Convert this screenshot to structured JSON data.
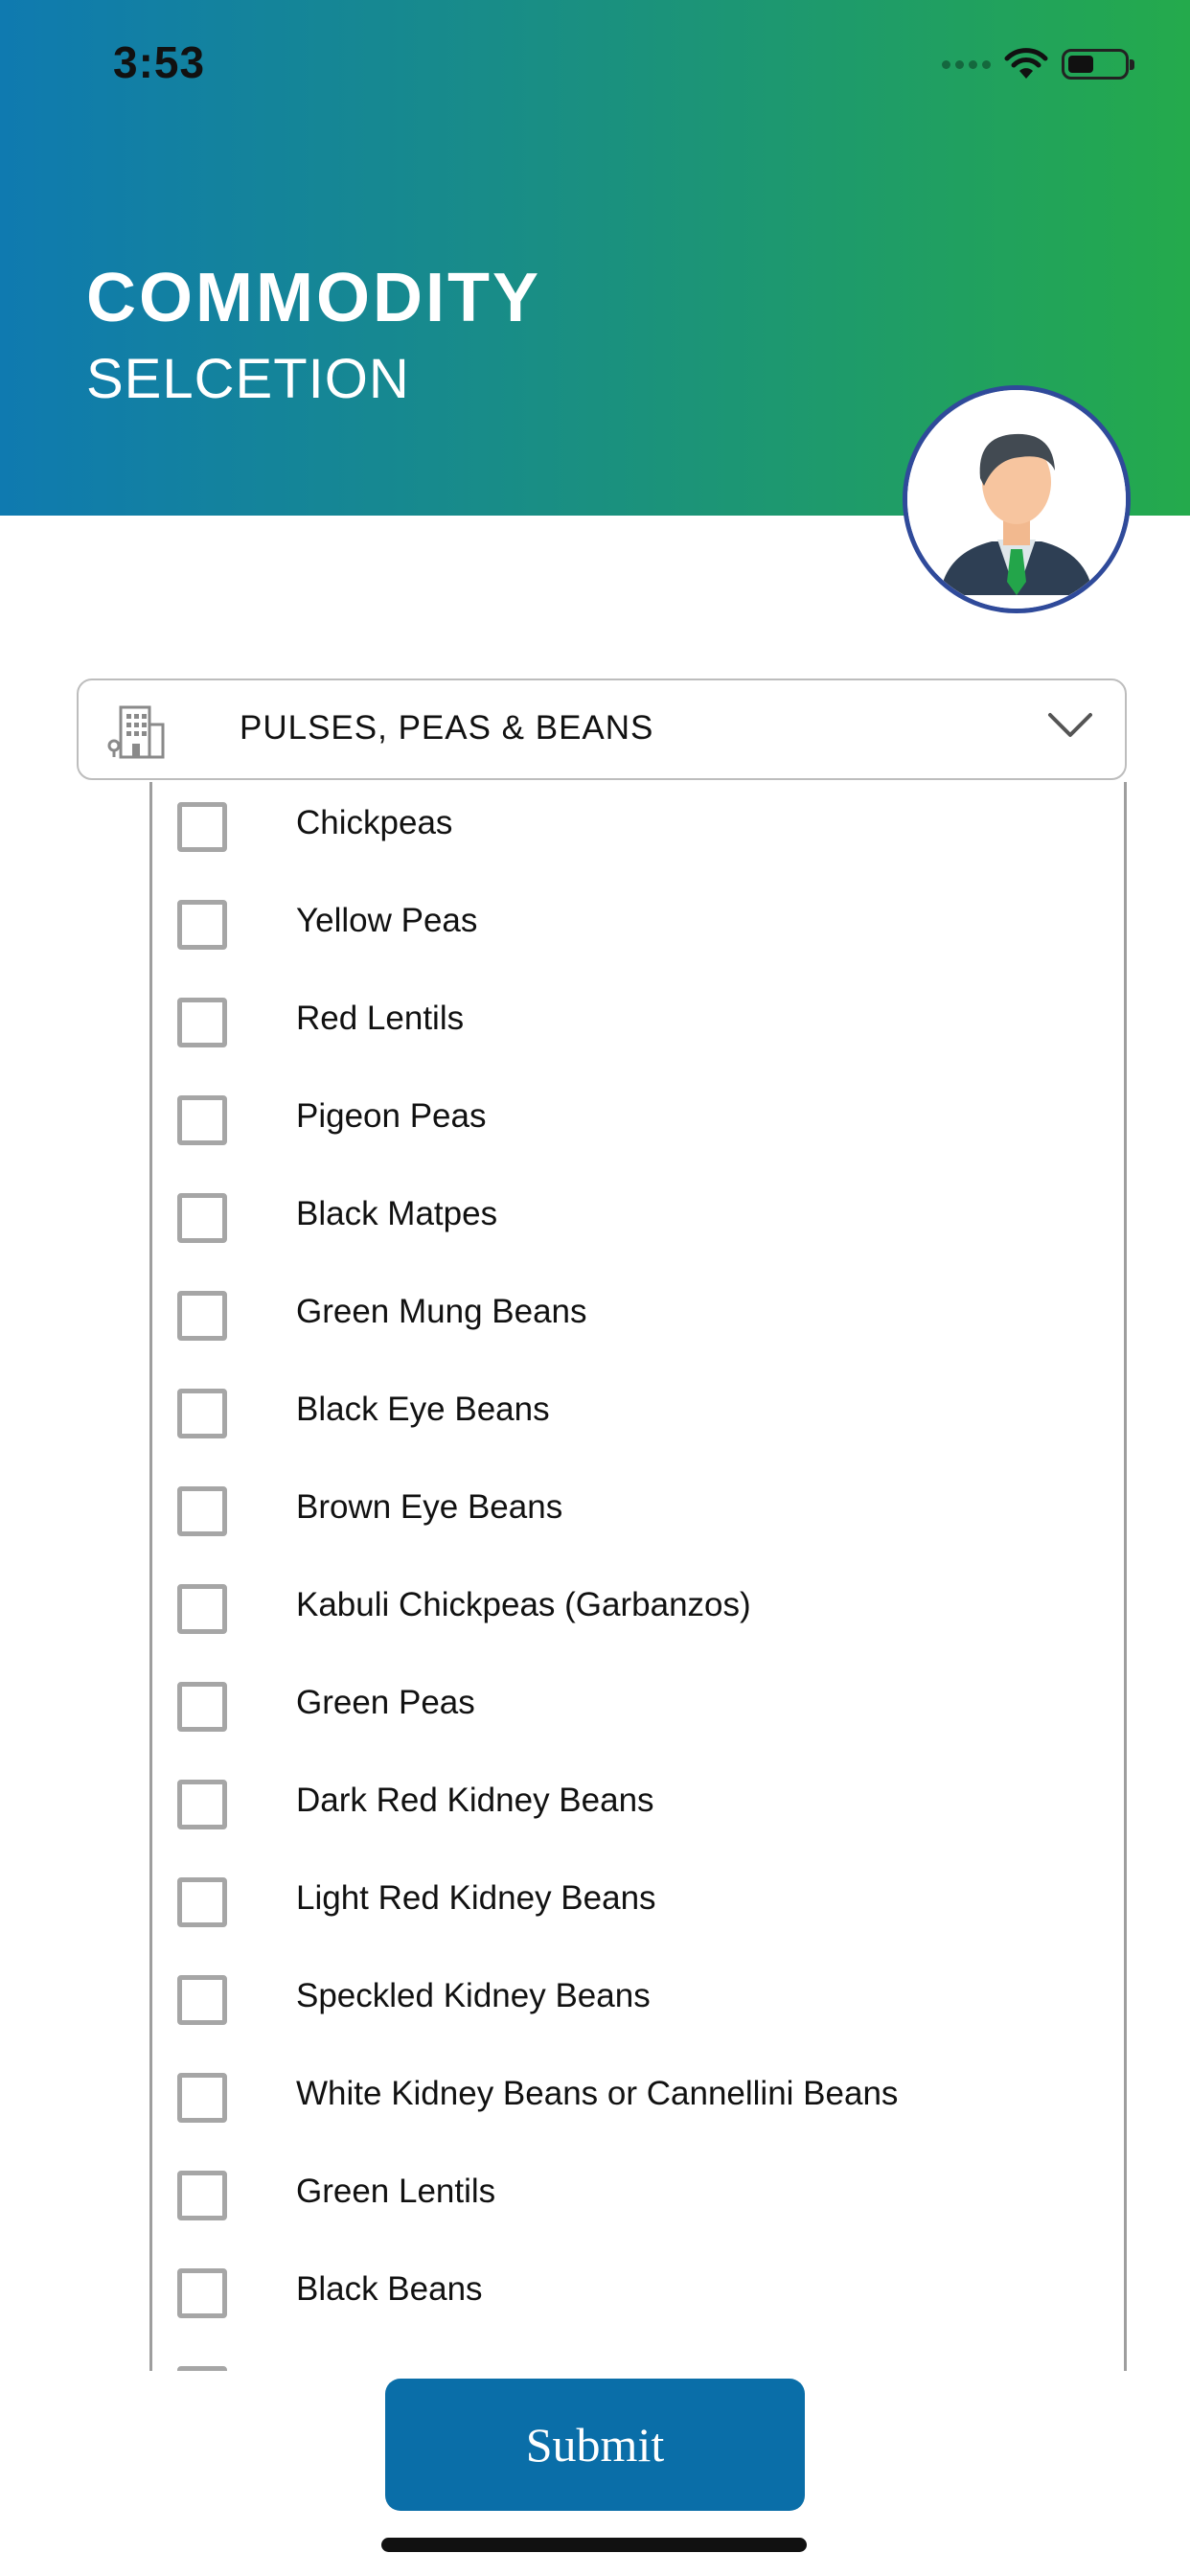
{
  "status_bar": {
    "time": "3:53"
  },
  "header": {
    "title": "COMMODITY",
    "subtitle": "SELCETION",
    "gradient_colors": [
      "#0f7ab0",
      "#24aa4c"
    ]
  },
  "dropdown": {
    "icon": "building-icon",
    "selected_label": "PULSES, PEAS & BEANS",
    "chevron": "chevron-down-icon"
  },
  "commodities": [
    {
      "label": "Chickpeas",
      "checked": false
    },
    {
      "label": "Yellow Peas",
      "checked": false
    },
    {
      "label": "Red Lentils",
      "checked": false
    },
    {
      "label": "Pigeon Peas",
      "checked": false
    },
    {
      "label": "Black Matpes",
      "checked": false
    },
    {
      "label": "Green Mung Beans",
      "checked": false
    },
    {
      "label": "Black Eye Beans",
      "checked": false
    },
    {
      "label": "Brown Eye Beans",
      "checked": false
    },
    {
      "label": "Kabuli Chickpeas (Garbanzos)",
      "checked": false
    },
    {
      "label": "Green Peas",
      "checked": false
    },
    {
      "label": "Dark Red Kidney Beans",
      "checked": false
    },
    {
      "label": "Light Red Kidney Beans",
      "checked": false
    },
    {
      "label": "Speckled Kidney Beans",
      "checked": false
    },
    {
      "label": "White Kidney Beans or Cannellini Beans",
      "checked": false
    },
    {
      "label": "Green Lentils",
      "checked": false
    },
    {
      "label": "Black Beans",
      "checked": false
    }
  ],
  "actions": {
    "submit_label": "Submit",
    "accent_color": "#0a6ea8"
  }
}
